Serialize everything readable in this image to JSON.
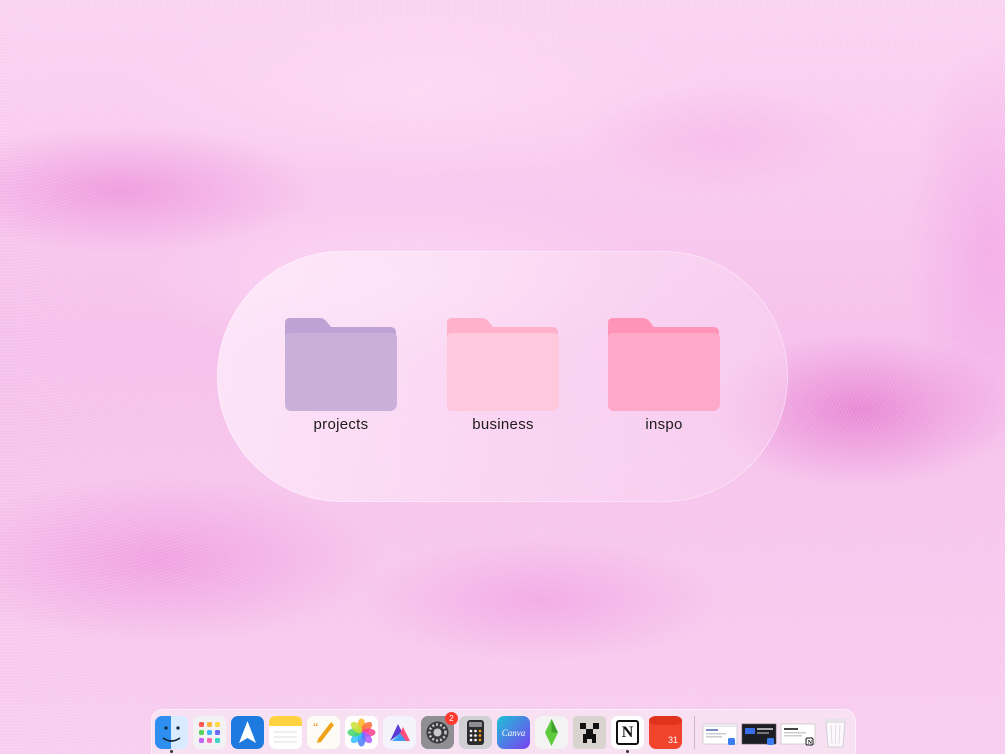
{
  "desktop": {
    "folders": [
      {
        "label": "projects",
        "color": "#c9b0da",
        "tab_color": "#bfa2d4"
      },
      {
        "label": "business",
        "color": "#ffc8dc",
        "tab_color": "#ffb1cb"
      },
      {
        "label": "inspo",
        "color": "#ffa9c8",
        "tab_color": "#ff93b8"
      }
    ]
  },
  "dock": {
    "apps": [
      {
        "name": "finder-icon",
        "running": true
      },
      {
        "name": "launchpad-icon",
        "running": false
      },
      {
        "name": "spark-mail-icon",
        "running": false
      },
      {
        "name": "notes-icon",
        "running": false
      },
      {
        "name": "pages-icon",
        "running": false
      },
      {
        "name": "photos-icon",
        "running": false
      },
      {
        "name": "affinity-icon",
        "running": false
      },
      {
        "name": "system-settings-icon",
        "running": false,
        "badge": "2"
      },
      {
        "name": "calculator-icon",
        "running": false
      },
      {
        "name": "canva-icon",
        "running": false,
        "text": "Canva"
      },
      {
        "name": "sims-icon",
        "running": false
      },
      {
        "name": "minecraft-icon",
        "running": false
      },
      {
        "name": "notion-icon",
        "running": true,
        "text": "N"
      },
      {
        "name": "fantastical-icon",
        "running": false,
        "text": "31"
      }
    ],
    "minimized_windows": 3,
    "trash": {
      "name": "trash-icon"
    }
  }
}
